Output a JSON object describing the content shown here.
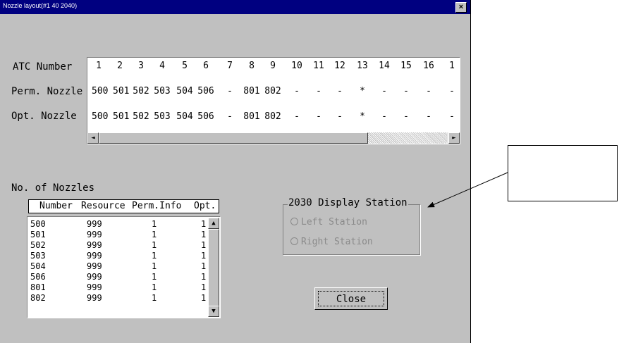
{
  "window": {
    "title": "Nozzle layout(#1 40 2040)",
    "close_glyph": "×"
  },
  "atc": {
    "row_labels": {
      "atc": "ATC Number",
      "perm": "Perm. Nozzle",
      "opt": "Opt. Nozzle"
    },
    "numbers": [
      "1",
      "2",
      "3",
      "4",
      "5",
      "6",
      "7",
      "8",
      "9",
      "10",
      "11",
      "12",
      "13",
      "14",
      "15",
      "16",
      "1"
    ],
    "perm": [
      "500",
      "501",
      "502",
      "503",
      "504",
      "506",
      "-",
      "801",
      "802",
      "-",
      "-",
      "-",
      "*",
      "-",
      "-",
      "-",
      "-"
    ],
    "opt": [
      "500",
      "501",
      "502",
      "503",
      "504",
      "506",
      "-",
      "801",
      "802",
      "-",
      "-",
      "-",
      "*",
      "-",
      "-",
      "-",
      "-"
    ],
    "scroll_left": "◄",
    "scroll_right": "►"
  },
  "nozzles": {
    "title": "No. of Nozzles",
    "headers": [
      "Number",
      "Resource",
      "Perm.Info",
      "Opt."
    ],
    "rows": [
      [
        "500",
        "999",
        "1",
        "1"
      ],
      [
        "501",
        "999",
        "1",
        "1"
      ],
      [
        "502",
        "999",
        "1",
        "1"
      ],
      [
        "503",
        "999",
        "1",
        "1"
      ],
      [
        "504",
        "999",
        "1",
        "1"
      ],
      [
        "506",
        "999",
        "1",
        "1"
      ],
      [
        "801",
        "999",
        "1",
        "1"
      ],
      [
        "802",
        "999",
        "1",
        "1"
      ]
    ],
    "scroll_up": "▲",
    "scroll_down": "▼"
  },
  "display_station": {
    "title": "2030 Display Station",
    "options": [
      "Left Station",
      "Right Station"
    ]
  },
  "close_button": "Close"
}
